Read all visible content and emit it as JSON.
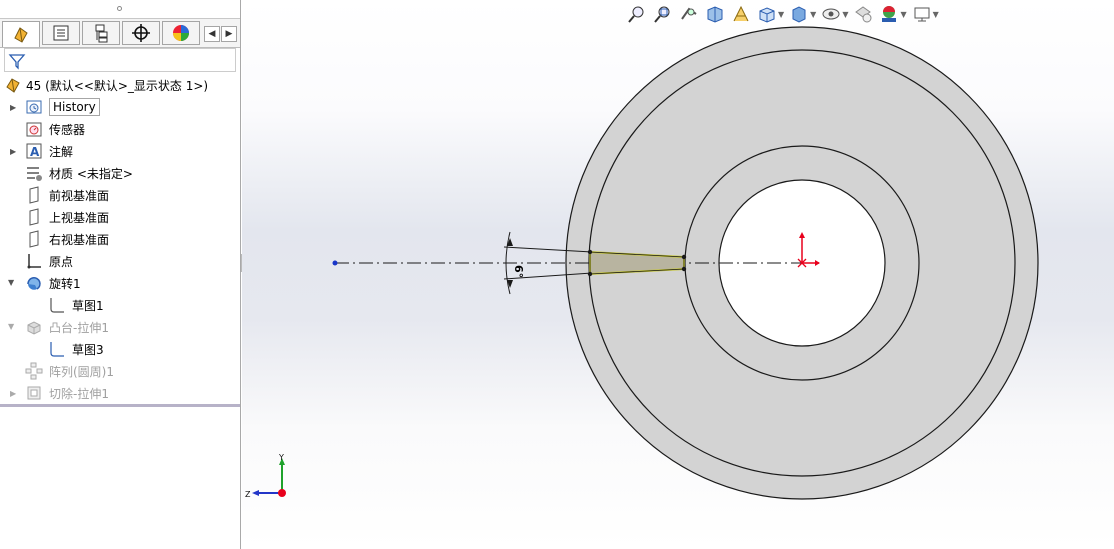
{
  "feature_tree": {
    "root_label": "45  (默认<<默认>_显示状态 1>)",
    "items": [
      {
        "label": "History",
        "icon": "history-icon",
        "expandable": true,
        "dim": false
      },
      {
        "label": "传感器",
        "icon": "sensor-icon",
        "expandable": false,
        "dim": false
      },
      {
        "label": "注解",
        "icon": "annotation-icon",
        "expandable": true,
        "dim": false
      },
      {
        "label": "材质 <未指定>",
        "icon": "material-icon",
        "expandable": false,
        "dim": false
      },
      {
        "label": "前视基准面",
        "icon": "plane-icon",
        "expandable": false,
        "dim": false
      },
      {
        "label": "上视基准面",
        "icon": "plane-icon",
        "expandable": false,
        "dim": false
      },
      {
        "label": "右视基准面",
        "icon": "plane-icon",
        "expandable": false,
        "dim": false
      },
      {
        "label": "原点",
        "icon": "origin-icon",
        "expandable": false,
        "dim": false
      },
      {
        "label": "旋转1",
        "icon": "revolve-icon",
        "expandable": true,
        "expanded": true,
        "dim": false
      },
      {
        "label": "草图1",
        "icon": "sketch-icon",
        "child": true,
        "dim": false
      },
      {
        "label": "凸台-拉伸1",
        "icon": "boss-extrude-icon",
        "expandable": true,
        "expanded": true,
        "dim": true
      },
      {
        "label": "草图3",
        "icon": "sketch-icon",
        "child": true,
        "dim": false
      },
      {
        "label": "阵列(圆周)1",
        "icon": "circular-pattern-icon",
        "expandable": false,
        "dim": true
      },
      {
        "label": "切除-拉伸1",
        "icon": "cut-extrude-icon",
        "expandable": true,
        "dim": true
      }
    ]
  },
  "panel_tabs": [
    "feature-manager-tab",
    "property-manager-tab",
    "configuration-manager-tab",
    "dimxpert-manager-tab",
    "display-manager-tab"
  ],
  "heads_up_toolbar": [
    "zoom-to-fit-icon",
    "zoom-to-area-icon",
    "previous-view-icon",
    "section-view-icon",
    "dynamic-annotation-icon",
    "view-orientation-icon",
    "display-style-icon",
    "hide-show-items-icon",
    "edit-appearance-icon",
    "apply-scene-icon",
    "view-settings-icon"
  ],
  "sketch": {
    "dimension_text": "6°"
  },
  "triad": {
    "y_label": "Y",
    "z_label": "Z"
  },
  "colors": {
    "part_fill": "#d3d3d3",
    "sketch_fill": "#b8b4a0",
    "sketch_outline": "#c8c83a",
    "origin_red": "#e8001c"
  }
}
